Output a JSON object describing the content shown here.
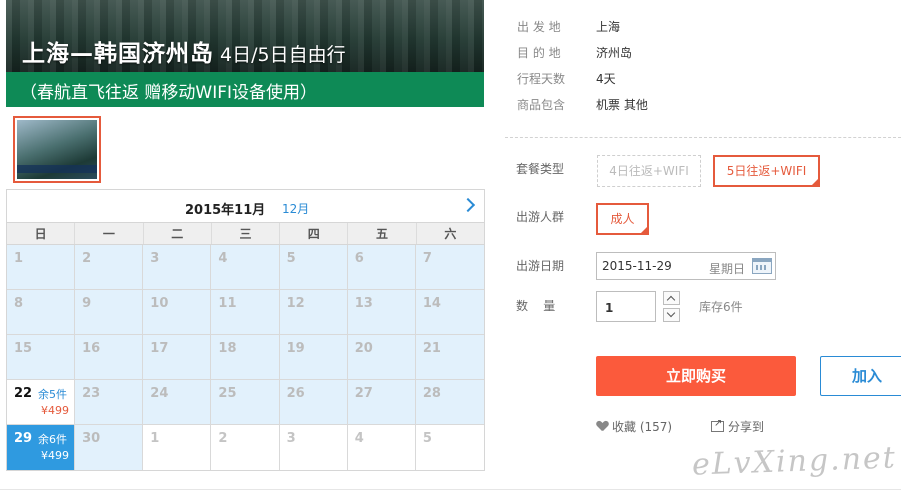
{
  "banner": {
    "title": "上海—韩国济州岛",
    "subtitle": "4日/5日自由行",
    "strip": "（春航直飞往返  赠移动WIFI设备使用）"
  },
  "calendar": {
    "month_label": "2015年11月",
    "next_month_label": "12月",
    "weekdays": [
      "日",
      "一",
      "二",
      "三",
      "四",
      "五",
      "六"
    ],
    "days": [
      {
        "d": "1",
        "state": "past"
      },
      {
        "d": "2",
        "state": "past"
      },
      {
        "d": "3",
        "state": "past"
      },
      {
        "d": "4",
        "state": "past"
      },
      {
        "d": "5",
        "state": "past"
      },
      {
        "d": "6",
        "state": "past"
      },
      {
        "d": "7",
        "state": "past"
      },
      {
        "d": "8",
        "state": "past"
      },
      {
        "d": "9",
        "state": "past"
      },
      {
        "d": "10",
        "state": "past"
      },
      {
        "d": "11",
        "state": "past"
      },
      {
        "d": "12",
        "state": "past"
      },
      {
        "d": "13",
        "state": "past"
      },
      {
        "d": "14",
        "state": "past"
      },
      {
        "d": "15",
        "state": "past"
      },
      {
        "d": "16",
        "state": "past"
      },
      {
        "d": "17",
        "state": "past"
      },
      {
        "d": "18",
        "state": "past"
      },
      {
        "d": "19",
        "state": "past"
      },
      {
        "d": "20",
        "state": "past"
      },
      {
        "d": "21",
        "state": "past"
      },
      {
        "d": "22",
        "state": "avail",
        "stock": "余5件",
        "price": "¥499"
      },
      {
        "d": "23",
        "state": "past"
      },
      {
        "d": "24",
        "state": "past"
      },
      {
        "d": "25",
        "state": "past"
      },
      {
        "d": "26",
        "state": "past"
      },
      {
        "d": "27",
        "state": "past"
      },
      {
        "d": "28",
        "state": "past"
      },
      {
        "d": "29",
        "state": "selected",
        "stock": "余6件",
        "price": "¥499"
      },
      {
        "d": "30",
        "state": "past"
      },
      {
        "d": "1",
        "state": "next"
      },
      {
        "d": "2",
        "state": "next"
      },
      {
        "d": "3",
        "state": "next"
      },
      {
        "d": "4",
        "state": "next"
      },
      {
        "d": "5",
        "state": "next"
      }
    ]
  },
  "info": [
    {
      "label": "出 发 地",
      "value": "上海"
    },
    {
      "label": "目 的 地",
      "value": "济州岛"
    },
    {
      "label": "行程天数",
      "value": "4天"
    },
    {
      "label": "商品包含",
      "value": "机票  其他"
    }
  ],
  "package": {
    "label": "套餐类型",
    "options": [
      {
        "text": "4日往返+WIFI",
        "state": "disabled"
      },
      {
        "text": "5日往返+WIFI",
        "state": "active"
      }
    ]
  },
  "traveler": {
    "label": "出游人群",
    "option": "成人"
  },
  "date": {
    "label": "出游日期",
    "value": "2015-11-29",
    "weekday": "星期日"
  },
  "quantity": {
    "label": "数    量",
    "value": "1",
    "stock": "库存6件"
  },
  "actions": {
    "buy": "立即购买",
    "cart": "加入"
  },
  "social": {
    "favorite": "收藏 (157)",
    "share": "分享到"
  },
  "watermark": "eLvXing.net",
  "colors": {
    "accent": "#fb5a3c",
    "link": "#2a8bd5",
    "selected_day": "#2f9ae0",
    "past_day": "#e2f1fc",
    "banner_strip": "#0e8a56"
  }
}
